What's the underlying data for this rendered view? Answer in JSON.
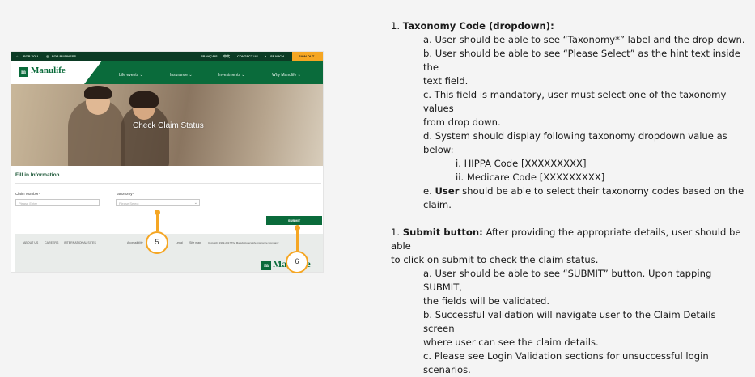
{
  "mockup": {
    "topbar": {
      "for_you": "FOR YOU",
      "for_business": "FOR BUSINESS",
      "francais": "FRANÇAIS",
      "chinese": "中文",
      "contact_us": "CONTACT US",
      "search": "SEARCH",
      "sign_out": "SIGN OUT"
    },
    "logo": "Manulife",
    "logo_mark": "m",
    "nav": [
      "Life events ⌄",
      "Insurance ⌄",
      "Investments ⌄",
      "Why Manulife ⌄"
    ],
    "hero_title": "Check Claim Status",
    "form": {
      "section_title": "Fill in Information",
      "claim_label": "Claim Number*",
      "claim_placeholder": "Please Enter",
      "taxonomy_label": "Taxonomy*",
      "taxonomy_placeholder": "Please Select",
      "submit": "SUBMIT"
    },
    "footer": {
      "links": [
        "ABOUT US",
        "CAREERS",
        "INTERNATIONAL SITES"
      ],
      "right_links": [
        "Accessibility",
        "Legal",
        "Site map",
        "Copyright 1999-2017 The Manufacturers Life Insurance Company"
      ],
      "logo": "Manulife"
    }
  },
  "callouts": [
    "5",
    "6"
  ],
  "doc": {
    "taxonomy": {
      "num": "1.",
      "title": "Taxonomy Code (dropdown):",
      "a": "a. User should be able to see “Taxonomy*” label and the drop down.",
      "b1": "b. User should be able to see “Please Select” as the hint text inside the",
      "b2": "text field.",
      "c1": "c. This field is mandatory, user must select one of the taxonomy values",
      "c2": "from drop down.",
      "d1": "d. System should display following taxonomy dropdown value as",
      "d2": "below:",
      "di": "i. HIPPA Code [XXXXXXXXX]",
      "dii": "ii. Medicare Code [XXXXXXXXX]",
      "e_prefix": "e.",
      "e_bold": "User",
      "e1": "should be able to select their taxonomy codes based on the",
      "e2": "claim."
    },
    "submit": {
      "num": "1.",
      "title": "Submit button:",
      "line1": "After providing the appropriate details, user should be able",
      "line2": "to click on submit to check the claim status.",
      "a1": "a. User should be able to see “SUBMIT” button. Upon tapping SUBMIT,",
      "a2": "the fields will be validated.",
      "b1": "b. Successful validation will navigate user to the Claim Details screen",
      "b2": "where user can see the claim details.",
      "c": "c. Please see Login Validation sections for unsuccessful login scenarios."
    }
  }
}
